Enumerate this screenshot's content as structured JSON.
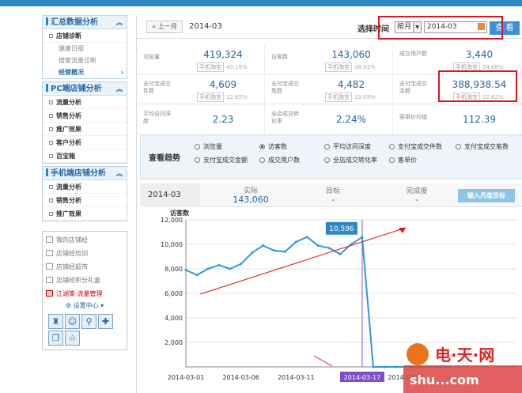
{
  "sidebar": {
    "sections": [
      {
        "title": "汇总数据分析",
        "items": [
          {
            "label": "店铺诊断",
            "subs": [
              "健康日报",
              "搜索流量诊断"
            ]
          },
          {
            "label": "",
            "subs": []
          }
        ],
        "active_sub": "经营概况"
      },
      {
        "title": "PC端店铺分析",
        "items": [
          "流量分析",
          "销售分析",
          "推广效果",
          "客户分析",
          "百宝箱"
        ]
      },
      {
        "title": "手机端店铺分析",
        "items": [
          "流量分析",
          "销售分析",
          "推广效果"
        ]
      }
    ],
    "extra_items": [
      "我的店铺经",
      "店铺经培训",
      "店铺经超市",
      "店铺经积分礼盒",
      "江湖策·流量管理"
    ],
    "settings_label": "设置中心"
  },
  "datebar": {
    "prev_label": "« 上一月",
    "current_date": "2014-03",
    "select_label": "选择时间",
    "period": "按月",
    "date_value": "2014-03",
    "view_label": "查 看"
  },
  "metrics": [
    {
      "label": "浏览量",
      "value": "419,324",
      "tag": "手机淘宝",
      "pct": "49.16%"
    },
    {
      "label": "访客数",
      "value": "143,060",
      "tag": "手机淘宝",
      "pct": "38.91%"
    },
    {
      "label": "成交用户数",
      "value": "3,440",
      "tag": "手机淘宝",
      "pct": "34.68%"
    },
    {
      "label": "支付宝成交件数",
      "value": "4,609",
      "tag": "手机淘宝",
      "pct": "32.65%"
    },
    {
      "label": "支付宝成交笔数",
      "value": "4,482",
      "tag": "手机淘宝",
      "pct": "33.09%"
    },
    {
      "label": "支付宝成交金额",
      "value": "388,938.54",
      "tag": "手机淘宝",
      "pct": "32.62%"
    },
    {
      "label": "平均访问深度",
      "value": "2.23",
      "tag": "",
      "pct": ""
    },
    {
      "label": "全店成交转化率",
      "value": "2.24%",
      "tag": "",
      "pct": ""
    },
    {
      "label": "客单价均值",
      "value": "112.39",
      "tag": "",
      "pct": ""
    }
  ],
  "trend": {
    "title": "查看趋势",
    "options": [
      "浏览量",
      "访客数",
      "平均访问深度",
      "支付宝成交件数",
      "支付宝成交笔数",
      "支付宝成交金额",
      "成交用户数",
      "全店成交转化率",
      "客单价"
    ],
    "selected": "访客数"
  },
  "summary": {
    "month": "2014-03",
    "actual_label": "实际",
    "actual_value": "143,060",
    "target_label": "目标",
    "target_value": "-",
    "completion_label": "完成度",
    "completion_value": "-",
    "button_label": "输入月度目标"
  },
  "chart_data": {
    "type": "line",
    "ylabel": "访客数",
    "ylim": [
      0,
      12000
    ],
    "yticks": [
      "12,000",
      "10,000",
      "8,000",
      "6,000",
      "4,000",
      "2,000"
    ],
    "xticks": [
      "2014-03-01",
      "2014-03-06",
      "2014-03-11",
      "2014-03-17",
      "2014-03-21"
    ],
    "highlight_x": "2014-03-17",
    "tooltip": "10,596",
    "x": [
      1,
      2,
      3,
      4,
      5,
      6,
      7,
      8,
      9,
      10,
      11,
      12,
      13,
      14,
      15,
      16,
      17,
      18,
      19,
      20,
      21,
      22,
      23,
      24,
      25
    ],
    "values": [
      7900,
      7500,
      8000,
      8300,
      8000,
      8400,
      9300,
      9900,
      9500,
      9400,
      10200,
      10600,
      9900,
      9700,
      9200,
      10000,
      10596,
      0,
      0,
      0,
      0,
      0,
      0,
      0,
      0
    ],
    "line_color": "#2f9ad6"
  },
  "watermark": "shu...com"
}
